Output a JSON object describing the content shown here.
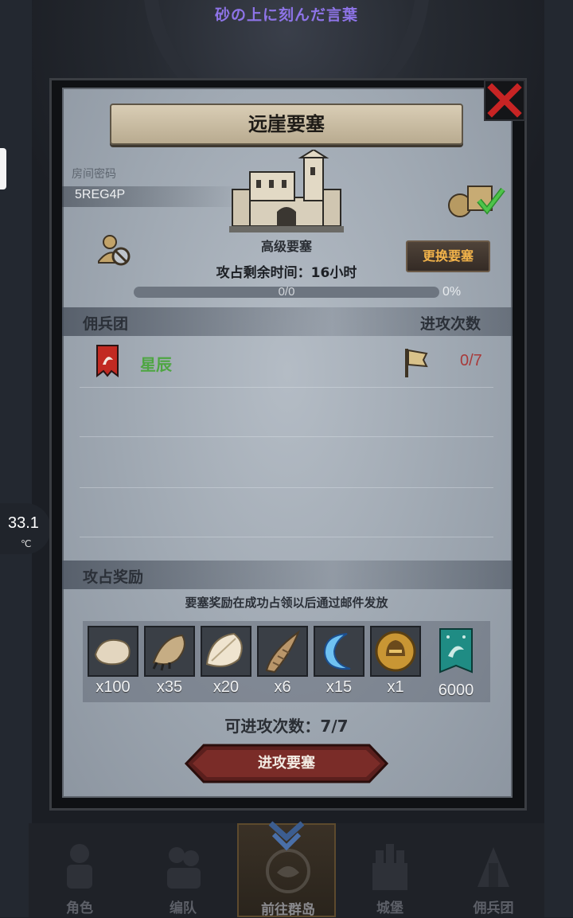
{
  "top_banner": "砂の上に刻んだ言葉",
  "device": {
    "temperature": "33.1",
    "temperature_unit": "℃"
  },
  "modal": {
    "title": "远崖要塞",
    "room_label": "房间密码",
    "room_code": "5REG4P",
    "fortress_name": "高级要塞",
    "switch_button": "更换要塞",
    "time_left": "攻占剩余时间：16小时",
    "progress": {
      "text": "0/0",
      "percent": "0%",
      "fraction": 0
    },
    "mercenary_header": "佣兵团",
    "attack_count_header": "进攻次数",
    "mercenaries": [
      {
        "name": "星辰",
        "attacks": "0/7"
      }
    ],
    "reward_header": "攻占奖励",
    "reward_note": "要塞奖励在成功占领以后通过邮件发放",
    "rewards": [
      {
        "icon": "fur-pelt-icon",
        "qty": "x100"
      },
      {
        "icon": "beast-claw-icon",
        "qty": "x35"
      },
      {
        "icon": "feather-hide-icon",
        "qty": "x20"
      },
      {
        "icon": "horn-icon",
        "qty": "x6"
      },
      {
        "icon": "blue-crescent-icon",
        "qty": "x15"
      },
      {
        "icon": "helmet-medal-icon",
        "qty": "x1"
      },
      {
        "icon": "guild-banner-icon",
        "qty": "6000"
      }
    ],
    "attempts": "可进攻次数：7/7",
    "attack_button": "进攻要塞"
  },
  "bottom_nav": [
    {
      "label": "角色",
      "icon": "knight-icon"
    },
    {
      "label": "编队",
      "icon": "squad-icon"
    },
    {
      "label": "前往群岛",
      "icon": "island-compass-icon",
      "active": true
    },
    {
      "label": "城堡",
      "icon": "castle-icon"
    },
    {
      "label": "佣兵团",
      "icon": "mercenary-icon"
    }
  ],
  "colors": {
    "accent_red": "#c72424",
    "merc_green": "#4ea642",
    "count_red": "#a83a3a",
    "button_gold": "#f2b34a"
  }
}
